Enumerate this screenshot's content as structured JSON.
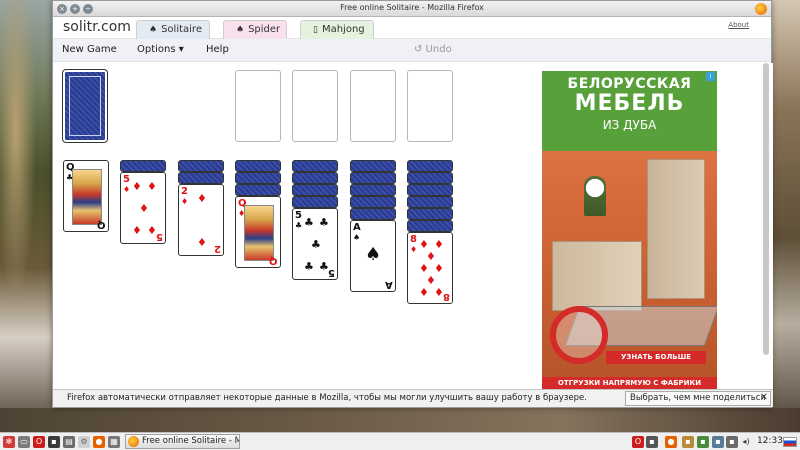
{
  "window": {
    "title": "Free online Solitaire - Mozilla Firefox"
  },
  "site": {
    "logo": "solitr.com",
    "tabs": [
      {
        "label": "Solitaire",
        "icon": "spade-icon"
      },
      {
        "label": "Spider",
        "icon": "spade-icon"
      },
      {
        "label": "Mahjong",
        "icon": "mahjong-tile-icon"
      }
    ],
    "about": "About"
  },
  "menu": {
    "new_game": "New Game",
    "options": "Options ▾",
    "help": "Help",
    "undo": "↺ Undo"
  },
  "game": {
    "foundations": 4,
    "stock": "face-down",
    "tableau": [
      {
        "hidden": 0,
        "faceup": [
          {
            "rank": "Q",
            "suit": "♣",
            "color": "black",
            "face": true
          }
        ]
      },
      {
        "hidden": 1,
        "faceup": [
          {
            "rank": "5",
            "suit": "♦",
            "color": "red"
          }
        ]
      },
      {
        "hidden": 2,
        "faceup": [
          {
            "rank": "2",
            "suit": "♦",
            "color": "red"
          }
        ]
      },
      {
        "hidden": 3,
        "faceup": [
          {
            "rank": "Q",
            "suit": "♦",
            "color": "red",
            "face": true
          }
        ]
      },
      {
        "hidden": 4,
        "faceup": [
          {
            "rank": "5",
            "suit": "♣",
            "color": "black"
          }
        ]
      },
      {
        "hidden": 5,
        "faceup": [
          {
            "rank": "A",
            "suit": "♠",
            "color": "black"
          }
        ]
      },
      {
        "hidden": 6,
        "faceup": [
          {
            "rank": "8",
            "suit": "♦",
            "color": "red"
          }
        ]
      }
    ]
  },
  "ad": {
    "line1": "БЕЛОРУССКАЯ",
    "line2": "МЕБЕЛЬ",
    "line3": "ИЗ ДУБА",
    "cta": "УЗНАТЬ БОЛЬШЕ",
    "bottom": "ОТГРУЗКИ НАПРЯМУЮ С ФАБРИКИ"
  },
  "notification": {
    "text": "Firefox автоматически отправляет некоторые данные в Mozilla, чтобы мы могли улучшить вашу работу в браузере.",
    "button": "Выбрать, чем мне поделиться",
    "close": "✕"
  },
  "taskbar": {
    "task_label": "Free online Solitaire - M...",
    "clock": "12:33"
  },
  "colors": {
    "card_back": "#2a3a8c",
    "suit_red": "#e01313",
    "ad_green": "#58a13a",
    "ad_red": "#d42a2a"
  }
}
